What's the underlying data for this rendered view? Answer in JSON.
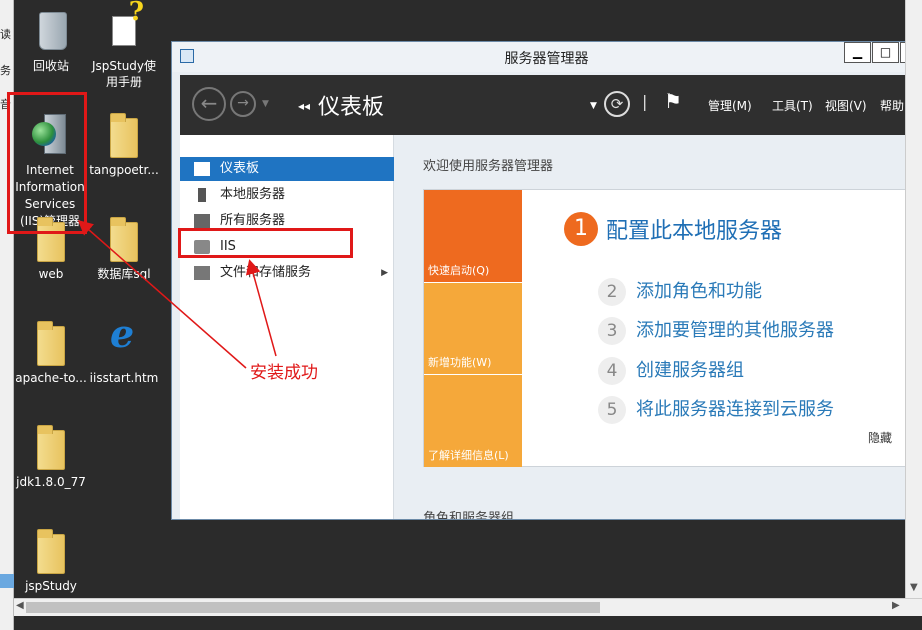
{
  "left_strip": {
    "labels": [
      "读",
      "务",
      "音"
    ]
  },
  "desktop": {
    "icons": [
      {
        "id": "recycle",
        "label": "回收站",
        "icon": "recycle-bin-icon"
      },
      {
        "id": "jspstudy-manual",
        "label": "JspStudy使用手册",
        "icon": "help-document-icon"
      },
      {
        "id": "iis",
        "label": "Internet Information Services (IIS)管理器",
        "icon": "iis-manager-icon"
      },
      {
        "id": "tangpoetr",
        "label": "tangpoetr...",
        "icon": "zip-folder-icon"
      },
      {
        "id": "web",
        "label": "web",
        "icon": "folder-icon"
      },
      {
        "id": "dbsql",
        "label": "数据库sql",
        "icon": "folder-icon"
      },
      {
        "id": "apache-to",
        "label": "apache-to...",
        "icon": "folder-icon"
      },
      {
        "id": "iisstart",
        "label": "iisstart.htm",
        "icon": "ie-document-icon"
      },
      {
        "id": "jdk",
        "label": "jdk1.8.0_77",
        "icon": "folder-icon"
      },
      {
        "id": "jspstudy",
        "label": "jspStudy",
        "icon": "folder-icon"
      }
    ]
  },
  "window": {
    "title": "服务器管理器",
    "controls": {
      "minimize": "▁",
      "maximize": "□",
      "close": "✕"
    },
    "toolbar": {
      "breadcrumb_arrows": "◂◂",
      "breadcrumb": "仪表板",
      "separator": "|",
      "menus": [
        "管理(M)",
        "工具(T)",
        "视图(V)",
        "帮助"
      ]
    },
    "sidebar": {
      "items": [
        {
          "label": "仪表板",
          "icon": "dashboard-icon",
          "active": true
        },
        {
          "label": "本地服务器",
          "icon": "local-server-icon"
        },
        {
          "label": "所有服务器",
          "icon": "all-servers-icon"
        },
        {
          "label": "IIS",
          "icon": "iis-icon"
        },
        {
          "label": "文件和存储服务",
          "icon": "file-storage-icon",
          "chevron": "▶"
        }
      ]
    },
    "content": {
      "welcome": "欢迎使用服务器管理器",
      "tiles": [
        {
          "label": "快速启动(Q)",
          "color": "#ee6a1f"
        },
        {
          "label": "新增功能(W)",
          "color": "#f5a83a"
        },
        {
          "label": "了解详细信息(L)",
          "color": "#f5a83a"
        }
      ],
      "steps": [
        {
          "num": "1",
          "text": "配置此本地服务器"
        },
        {
          "num": "2",
          "text": "添加角色和功能"
        },
        {
          "num": "3",
          "text": "添加要管理的其他服务器"
        },
        {
          "num": "4",
          "text": "创建服务器组"
        },
        {
          "num": "5",
          "text": "将此服务器连接到云服务"
        }
      ],
      "hide": "隐藏",
      "roles_heading": "角色和服务器组"
    }
  },
  "annotation": {
    "text": "安装成功",
    "color": "#e01818"
  },
  "colors": {
    "accent_blue": "#1f74c2",
    "toolbar_dark": "#2f2f2f",
    "orange": "#ee6a1f",
    "light_orange": "#f5a83a"
  }
}
